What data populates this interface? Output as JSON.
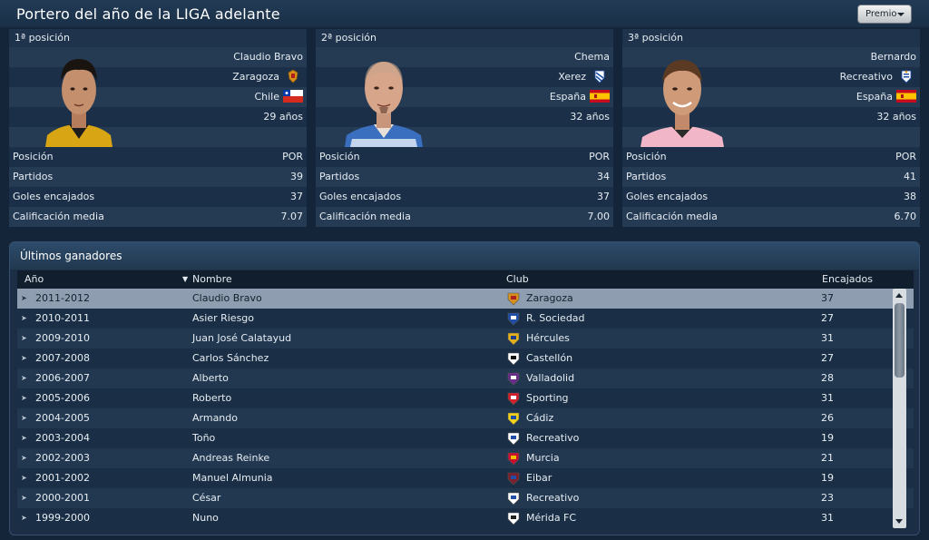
{
  "header": {
    "title": "Portero del año de la LIGA adelante",
    "award_button": "Premio"
  },
  "podium": [
    {
      "position": "1ª posición",
      "name": "Claudio Bravo",
      "club": "Zaragoza",
      "club_icon": "zaragoza-crest-icon",
      "nationality": "Chile",
      "flag_icon": "chile-flag-icon",
      "age": "29 años",
      "stats": [
        {
          "label": "Posición",
          "value": "POR"
        },
        {
          "label": "Partidos",
          "value": "39"
        },
        {
          "label": "Goles encajados",
          "value": "37"
        },
        {
          "label": "Calificación media",
          "value": "7.07"
        }
      ]
    },
    {
      "position": "2ª posición",
      "name": "Chema",
      "club": "Xerez",
      "club_icon": "xerez-crest-icon",
      "nationality": "España",
      "flag_icon": "spain-flag-icon",
      "age": "32 años",
      "stats": [
        {
          "label": "Posición",
          "value": "POR"
        },
        {
          "label": "Partidos",
          "value": "34"
        },
        {
          "label": "Goles encajados",
          "value": "37"
        },
        {
          "label": "Calificación media",
          "value": "7.00"
        }
      ]
    },
    {
      "position": "3ª posición",
      "name": "Bernardo",
      "club": "Recreativo",
      "club_icon": "recreativo-crest-icon",
      "nationality": "España",
      "flag_icon": "spain-flag-icon",
      "age": "32 años",
      "stats": [
        {
          "label": "Posición",
          "value": "POR"
        },
        {
          "label": "Partidos",
          "value": "41"
        },
        {
          "label": "Goles encajados",
          "value": "38"
        },
        {
          "label": "Calificación media",
          "value": "6.70"
        }
      ]
    }
  ],
  "winners": {
    "title": "Últimos ganadores",
    "columns": {
      "year": "Año",
      "name": "Nombre",
      "club": "Club",
      "conceded": "Encajados"
    },
    "rows": [
      {
        "year": "2011-2012",
        "name": "Claudio Bravo",
        "club": "Zaragoza",
        "conceded": "37",
        "crest": "zaragoza-crest-icon"
      },
      {
        "year": "2010-2011",
        "name": "Asier Riesgo",
        "club": "R. Sociedad",
        "conceded": "27",
        "crest": "real-sociedad-crest-icon"
      },
      {
        "year": "2009-2010",
        "name": "Juan José Calatayud",
        "club": "Hércules",
        "conceded": "31",
        "crest": "hercules-crest-icon"
      },
      {
        "year": "2007-2008",
        "name": "Carlos Sánchez",
        "club": "Castellón",
        "conceded": "27",
        "crest": "castellon-crest-icon"
      },
      {
        "year": "2006-2007",
        "name": "Alberto",
        "club": "Valladolid",
        "conceded": "28",
        "crest": "valladolid-crest-icon"
      },
      {
        "year": "2005-2006",
        "name": "Roberto",
        "club": "Sporting",
        "conceded": "31",
        "crest": "sporting-crest-icon"
      },
      {
        "year": "2004-2005",
        "name": "Armando",
        "club": "Cádiz",
        "conceded": "26",
        "crest": "cadiz-crest-icon"
      },
      {
        "year": "2003-2004",
        "name": "Toño",
        "club": "Recreativo",
        "conceded": "19",
        "crest": "recreativo-crest-icon"
      },
      {
        "year": "2002-2003",
        "name": "Andreas Reinke",
        "club": "Murcia",
        "conceded": "21",
        "crest": "murcia-crest-icon"
      },
      {
        "year": "2001-2002",
        "name": "Manuel Almunia",
        "club": "Eibar",
        "conceded": "19",
        "crest": "eibar-crest-icon"
      },
      {
        "year": "2000-2001",
        "name": "César",
        "club": "Recreativo",
        "conceded": "23",
        "crest": "recreativo-crest-icon"
      },
      {
        "year": "1999-2000",
        "name": "Nuno",
        "club": "Mérida FC",
        "conceded": "31",
        "crest": "merida-crest-icon"
      }
    ]
  },
  "colors": {
    "background": "#14253a",
    "row_dark": "#253b54",
    "row_light": "#1b3048",
    "selected_row": "#8e9eb0",
    "text": "#e6ecf2"
  }
}
